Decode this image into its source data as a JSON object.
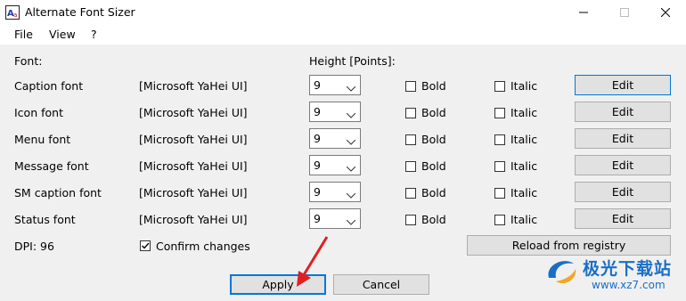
{
  "window": {
    "title": "Alternate Font Sizer",
    "icon": "app-icon",
    "controls": [
      "minimize-icon",
      "maximize-icon",
      "close-icon"
    ]
  },
  "menu": [
    "File",
    "View",
    "?"
  ],
  "headers": {
    "font": "Font:",
    "height": "Height [Points]:"
  },
  "rows": [
    {
      "name": "Caption font",
      "font": "[Microsoft YaHei UI]",
      "height": "9",
      "bold": "Bold",
      "italic": "Italic",
      "edit": "Edit"
    },
    {
      "name": "Icon font",
      "font": "[Microsoft YaHei UI]",
      "height": "9",
      "bold": "Bold",
      "italic": "Italic",
      "edit": "Edit"
    },
    {
      "name": "Menu font",
      "font": "[Microsoft YaHei UI]",
      "height": "9",
      "bold": "Bold",
      "italic": "Italic",
      "edit": "Edit"
    },
    {
      "name": "Message font",
      "font": "[Microsoft YaHei UI]",
      "height": "9",
      "bold": "Bold",
      "italic": "Italic",
      "edit": "Edit"
    },
    {
      "name": "SM caption font",
      "font": "[Microsoft YaHei UI]",
      "height": "9",
      "bold": "Bold",
      "italic": "Italic",
      "edit": "Edit"
    },
    {
      "name": "Status font",
      "font": "[Microsoft YaHei UI]",
      "height": "9",
      "bold": "Bold",
      "italic": "Italic",
      "edit": "Edit"
    }
  ],
  "dpi": "DPI: 96",
  "confirm": {
    "label": "Confirm changes",
    "checked": true
  },
  "reload_label": "Reload from registry",
  "apply_label": "Apply",
  "cancel_label": "Cancel",
  "watermark": {
    "brand": "极光下载站",
    "url": "www.xz7.com"
  },
  "colors": {
    "accent": "#0078d7",
    "arrow": "#e02020",
    "watermark": "#1a6fc4"
  }
}
